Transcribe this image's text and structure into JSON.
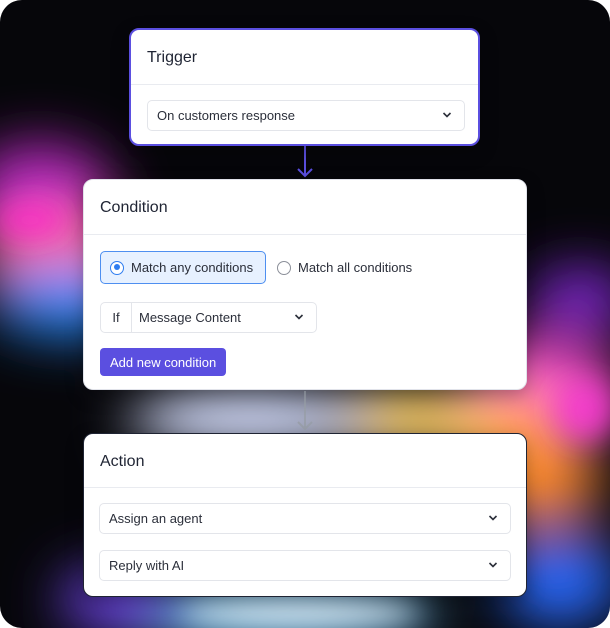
{
  "trigger": {
    "title": "Trigger",
    "select_value": "On customers response"
  },
  "condition": {
    "title": "Condition",
    "option_any": "Match any conditions",
    "option_all": "Match all conditions",
    "selected": "any",
    "if_label": "If",
    "field_value": "Message Content",
    "add_button": "Add new condition"
  },
  "action": {
    "title": "Action",
    "items": [
      {
        "value": "Assign an agent"
      },
      {
        "value": "Reply with AI"
      }
    ]
  },
  "colors": {
    "accent": "#5b4fe0",
    "radio_selected": "#2f7df0",
    "selected_bg": "#e7f1ff"
  },
  "icons": [
    "chevron-down-icon",
    "arrow-down-icon",
    "radio-icon"
  ]
}
